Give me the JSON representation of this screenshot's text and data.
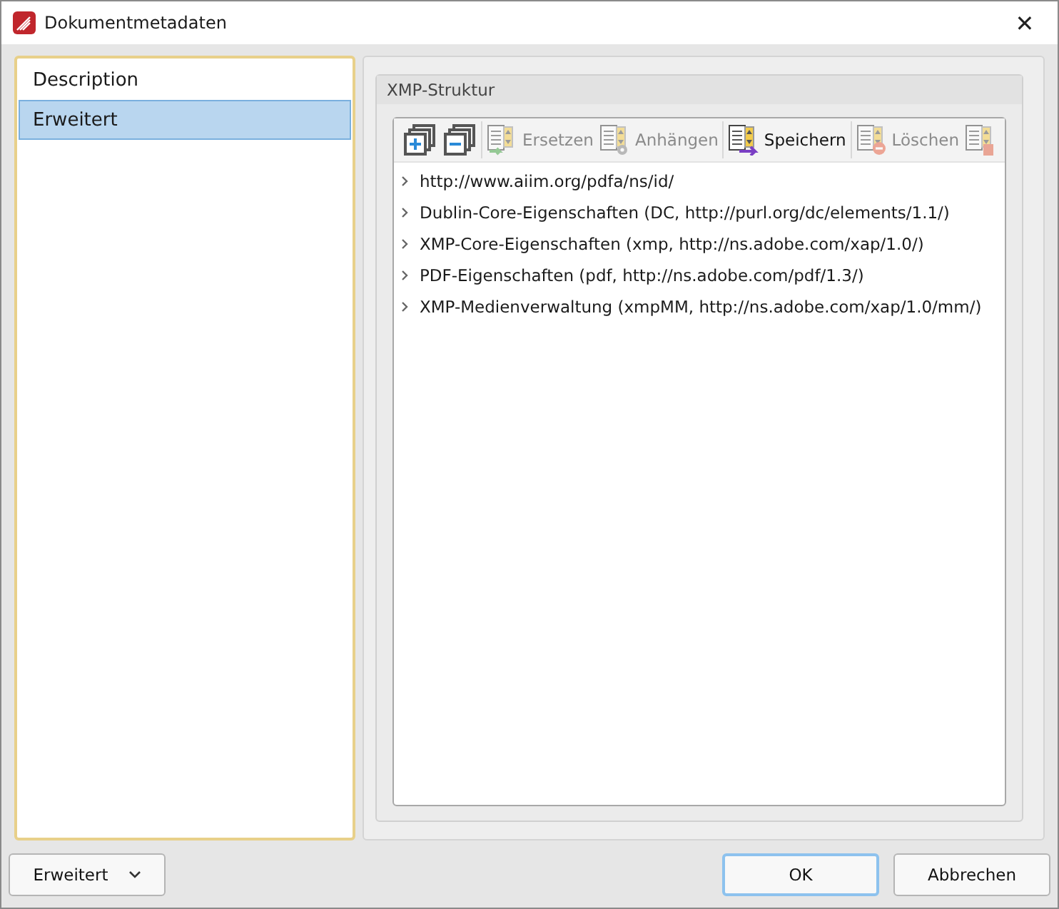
{
  "window": {
    "title": "Dokumentmetadaten",
    "close": "✕"
  },
  "sidebar": {
    "items": [
      {
        "label": "Description",
        "selected": false
      },
      {
        "label": "Erweitert",
        "selected": true
      }
    ]
  },
  "group": {
    "title": "XMP-Struktur",
    "toolbar": [
      {
        "kind": "icon",
        "disabled": false
      },
      {
        "kind": "icon",
        "disabled": false
      },
      {
        "kind": "text",
        "label": "Ersetzen",
        "disabled": true
      },
      {
        "kind": "text",
        "label": "Anhängen",
        "disabled": true
      },
      {
        "kind": "text",
        "label": "Speichern",
        "disabled": false
      },
      {
        "kind": "text",
        "label": "Löschen",
        "disabled": true
      },
      {
        "kind": "icon",
        "disabled": true
      }
    ],
    "tree": [
      {
        "label": "http://www.aiim.org/pdfa/ns/id/",
        "expanded": false
      },
      {
        "label": "Dublin-Core-Eigenschaften (DC, http://purl.org/dc/elements/1.1/)",
        "expanded": false
      },
      {
        "label": "XMP-Core-Eigenschaften (xmp, http://ns.adobe.com/xap/1.0/)",
        "expanded": false
      },
      {
        "label": "PDF-Eigenschaften (pdf, http://ns.adobe.com/pdf/1.3/)",
        "expanded": false
      },
      {
        "label": "XMP-Medienverwaltung (xmpMM, http://ns.adobe.com/xap/1.0/mm/)",
        "expanded": false
      }
    ]
  },
  "footer": {
    "mode": "Erweitert",
    "buttons": [
      {
        "label": "OK",
        "default": true
      },
      {
        "label": "Abbrechen",
        "default": false
      }
    ]
  }
}
